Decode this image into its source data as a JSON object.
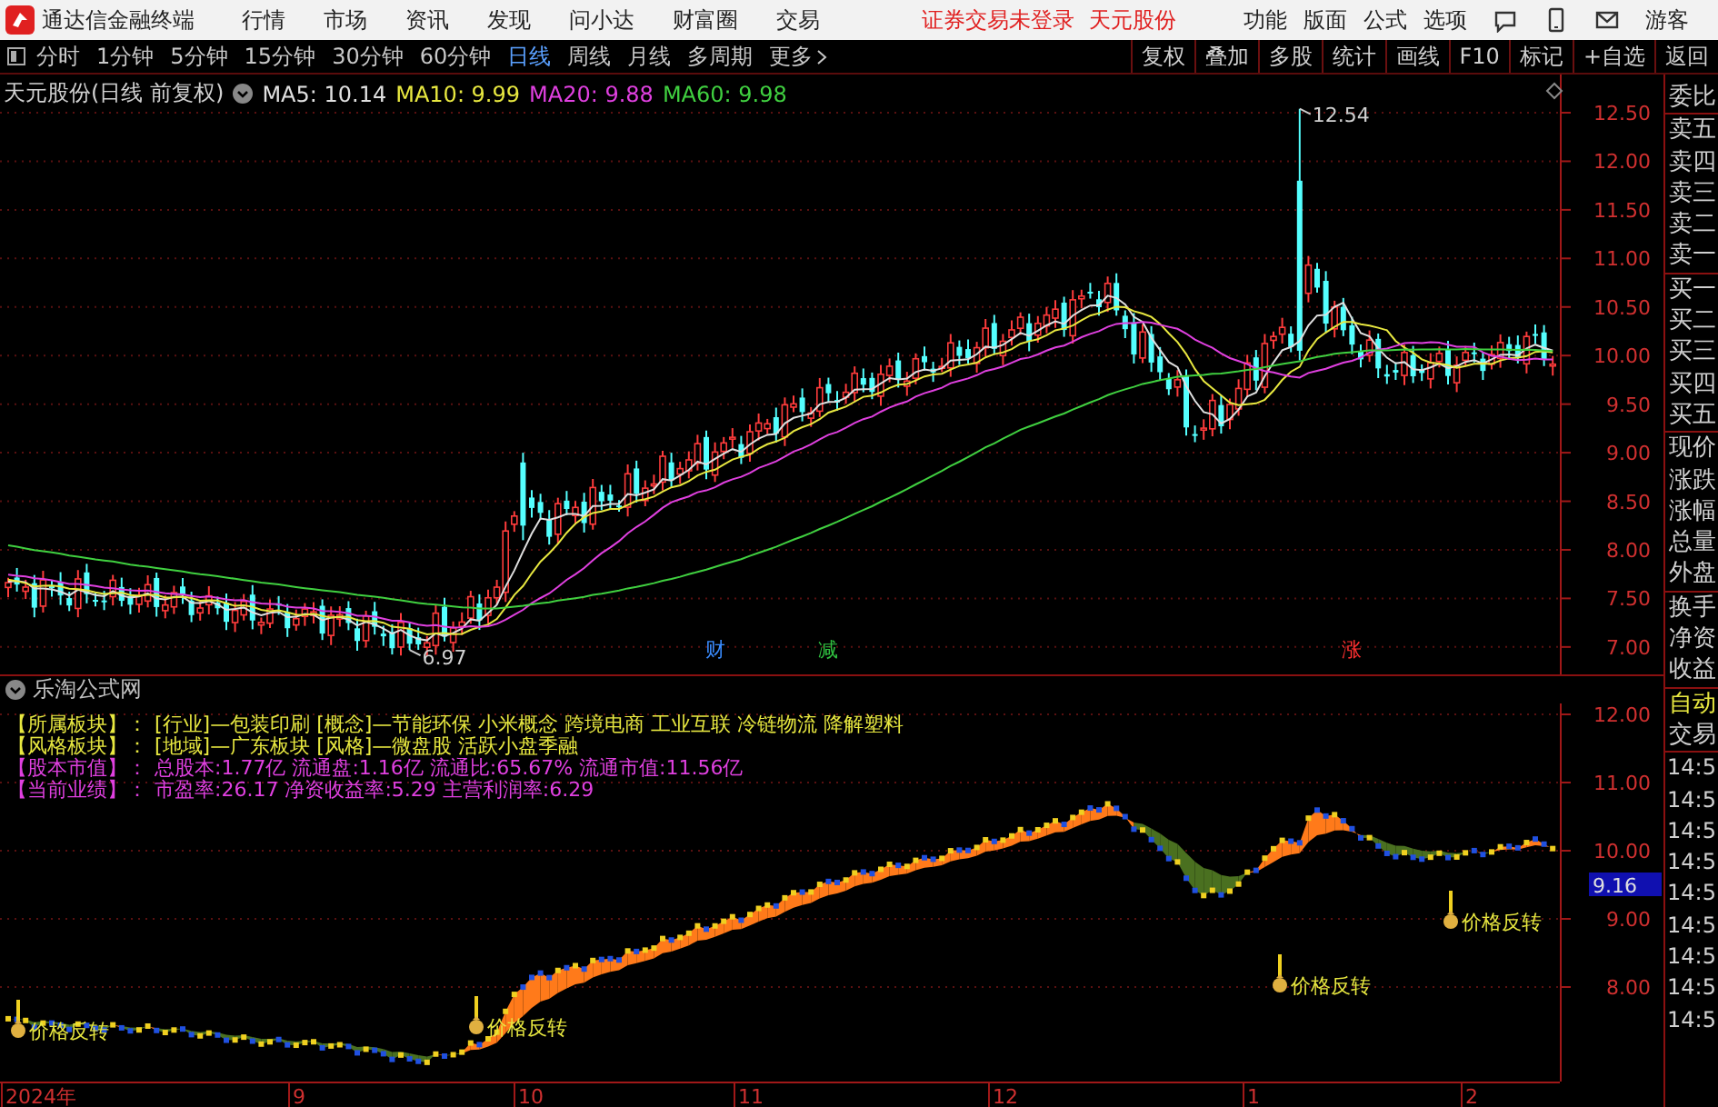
{
  "app_bar": {
    "title": "通达信金融终端",
    "menu": [
      "行情",
      "市场",
      "资讯",
      "发现",
      "问小达",
      "财富圈",
      "交易"
    ],
    "notices": [
      "证券交易未登录",
      "天元股份"
    ],
    "right_menu": [
      "功能",
      "版面",
      "公式",
      "选项"
    ],
    "user": "游客"
  },
  "period_bar": {
    "periods": [
      {
        "label": "分时",
        "selected": false
      },
      {
        "label": "1分钟",
        "selected": false
      },
      {
        "label": "5分钟",
        "selected": false
      },
      {
        "label": "15分钟",
        "selected": false
      },
      {
        "label": "30分钟",
        "selected": false
      },
      {
        "label": "60分钟",
        "selected": false
      },
      {
        "label": "日线",
        "selected": true
      },
      {
        "label": "周线",
        "selected": false
      },
      {
        "label": "月线",
        "selected": false
      },
      {
        "label": "多周期",
        "selected": false
      }
    ],
    "more": "更多",
    "tools": [
      "复权",
      "叠加",
      "多股",
      "统计",
      "画线",
      "F10",
      "标记",
      "+自选",
      "返回"
    ]
  },
  "main_chart": {
    "title": "天元股份(日线 前复权)",
    "indicators": [
      {
        "label": "MA5: 10.14",
        "color": "#e0e0e0"
      },
      {
        "label": "MA10: 9.99",
        "color": "#e8e840"
      },
      {
        "label": "MA20: 9.88",
        "color": "#e040e0"
      },
      {
        "label": "MA60: 9.98",
        "color": "#40d040"
      }
    ],
    "y_labels": [
      "12.50",
      "12.00",
      "11.50",
      "11.00",
      "10.50",
      "10.00",
      "9.50",
      "9.00",
      "8.50",
      "8.00",
      "7.50",
      "7.00"
    ],
    "high_label": "12.54",
    "low_label": "6.97",
    "event_marks": [
      {
        "text": "财",
        "color": "#3a8cff"
      },
      {
        "text": "减",
        "color": "#30c040"
      },
      {
        "text": "涨",
        "color": "#ff3030"
      }
    ]
  },
  "lower_panel": {
    "title": "乐淘公式网",
    "info": [
      {
        "label": "【所属板块】：",
        "value": "[行业]—包装印刷 [概念]—节能环保 小米概念 跨境电商 工业互联 冷链物流 降解塑料",
        "color": "#e8e840"
      },
      {
        "label": "【风格板块】：",
        "value": "[地域]—广东板块 [风格]—微盘股 活跃小盘季融",
        "color": "#e8e840"
      },
      {
        "label": "【股本市值】：",
        "value": "总股本:1.77亿 流通盘:1.16亿 流通比:65.67% 流通市值:11.56亿",
        "color": "#e040e0"
      },
      {
        "label": "【当前业绩】：",
        "value": "市盈率:26.17 净资收益率:5.29 主营利润率:6.29",
        "color": "#e040e0"
      }
    ],
    "signals": [
      "价格反转",
      "价格反转",
      "价格反转",
      "价格反转"
    ],
    "y_labels": [
      "12.00",
      "11.00",
      "10.00",
      "9.00",
      "8.00"
    ],
    "current": "9.16"
  },
  "quote_panel": {
    "groups": [
      [
        "委比"
      ],
      [
        "卖五",
        "卖四",
        "卖三",
        "卖二",
        "卖一"
      ],
      [
        "买一",
        "买二",
        "买三",
        "买四",
        "买五"
      ],
      [
        "现价",
        "涨跌",
        "涨幅",
        "总量",
        "外盘"
      ],
      [
        "换手",
        "净资",
        "收益"
      ]
    ],
    "auto": "自动",
    "trade": "交易",
    "times": [
      "14:5",
      "14:5",
      "14:5",
      "14:5",
      "14:5",
      "14:5",
      "14:5",
      "14:5",
      "14:5"
    ]
  },
  "time_axis": [
    "2024年",
    "9",
    "10",
    "11",
    "12",
    "1",
    "2"
  ]
}
